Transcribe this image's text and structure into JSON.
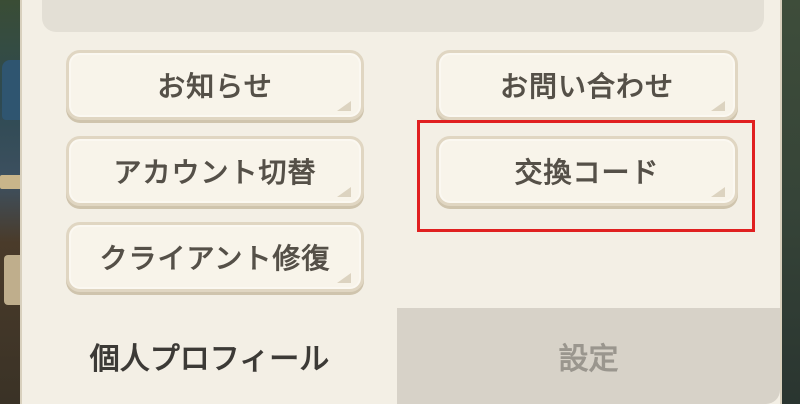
{
  "buttons": {
    "notice": "お知らせ",
    "contact": "お問い合わせ",
    "account_switch": "アカウント切替",
    "exchange_code": "交換コード",
    "client_repair": "クライアント修復"
  },
  "tabs": {
    "profile": "個人プロフィール",
    "settings": "設定"
  },
  "colors": {
    "panel": "#f3efe5",
    "button_text": "#555048",
    "highlight": "#e02020",
    "inactive_tab": "#d7d2c8"
  }
}
